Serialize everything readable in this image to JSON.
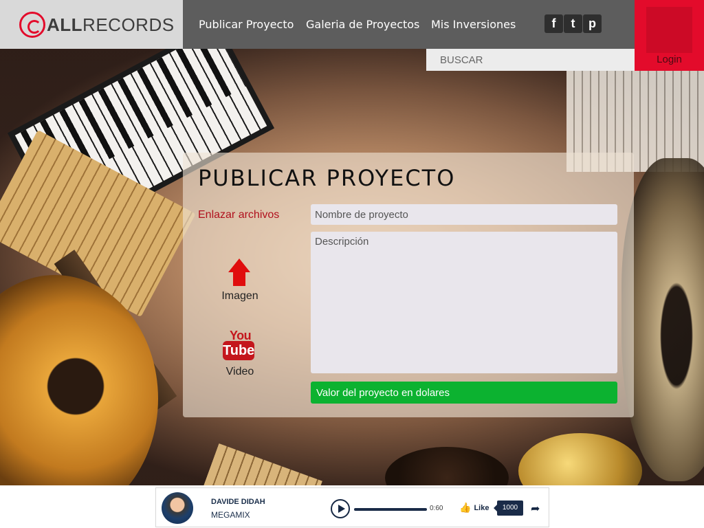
{
  "brand": {
    "logo_bold": "ALL",
    "logo_light": "RECORDS"
  },
  "nav": {
    "items": [
      {
        "label": "Publicar Proyecto"
      },
      {
        "label": "Galeria de Proyectos"
      },
      {
        "label": "Mis Inversiones"
      }
    ]
  },
  "social": {
    "facebook": "f",
    "twitter": "t",
    "pinterest": "p"
  },
  "search": {
    "placeholder": "BUSCAR"
  },
  "login": {
    "label": "Login"
  },
  "form": {
    "title": "PUBLICAR PROYECTO",
    "attach_label": "Enlazar archivos",
    "image_label": "Imagen",
    "video_label": "Video",
    "yt_you": "You",
    "yt_tube": "Tube",
    "name_placeholder": "Nombre de proyecto",
    "description_placeholder": "Descripción",
    "value_label": "Valor del proyecto en dolares"
  },
  "player": {
    "artist": "DAVIDE DIDAH",
    "track": "MEGAMIX",
    "time": "0:60",
    "like_label": "Like",
    "like_count": "1000"
  },
  "colors": {
    "accent": "#e30b2b",
    "header": "#5d5d5d",
    "green": "#0cb230"
  }
}
